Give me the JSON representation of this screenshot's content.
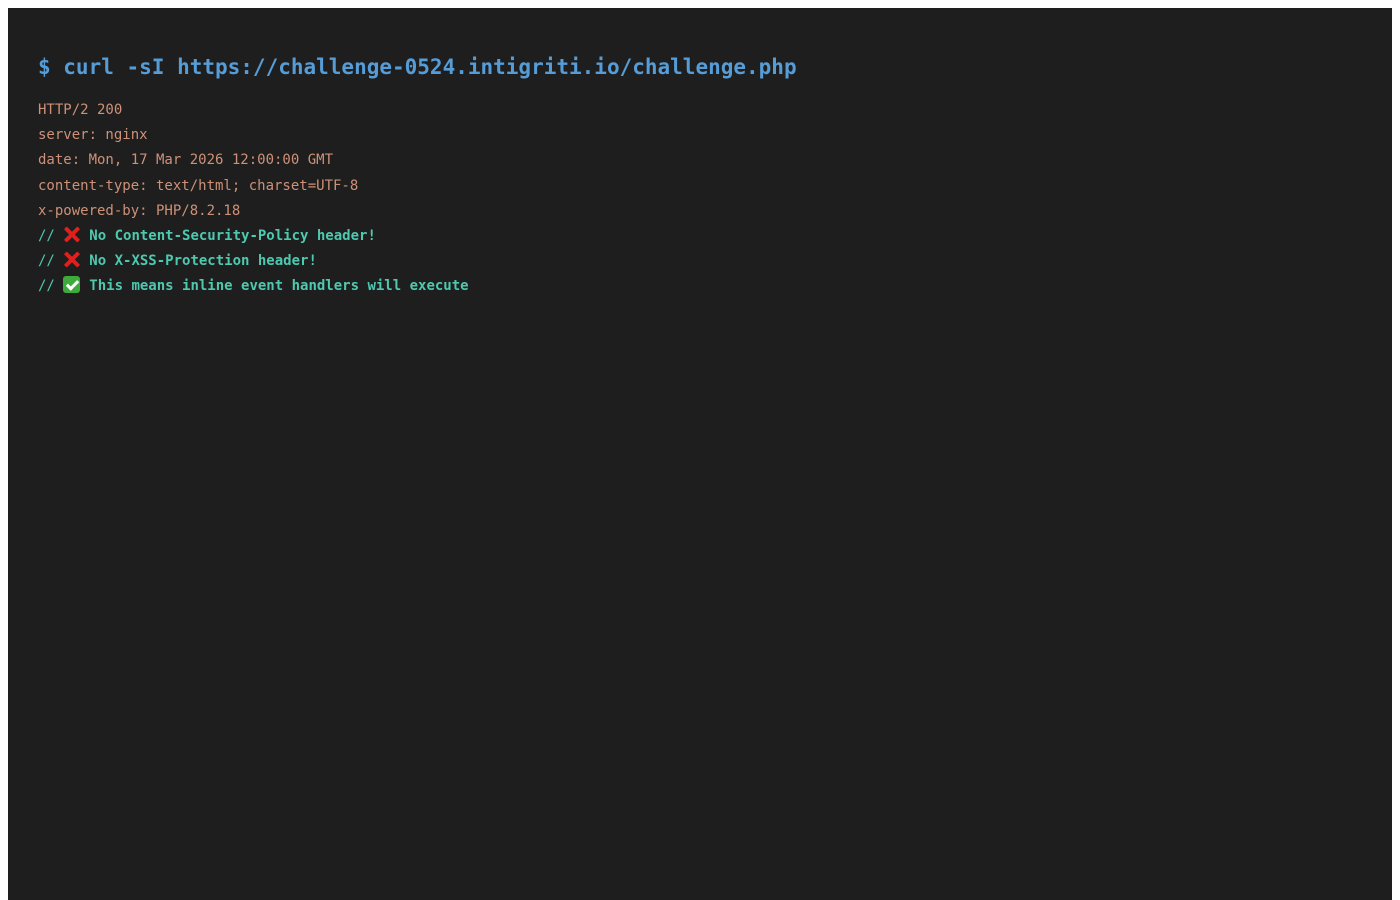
{
  "command": "$ curl -sI https://challenge-0524.intigriti.io/challenge.php",
  "headers": [
    "HTTP/2 200",
    "server: nginx",
    "date: Mon, 17 Mar 2026 12:00:00 GMT",
    "content-type: text/html; charset=UTF-8",
    "x-powered-by: PHP/8.2.18"
  ],
  "comments": [
    {
      "prefix": "// ",
      "icon": "cross-mark-icon",
      "text": "No Content-Security-Policy header!"
    },
    {
      "prefix": "// ",
      "icon": "cross-mark-icon",
      "text": "No X-XSS-Protection header!"
    },
    {
      "prefix": "// ",
      "icon": "check-mark-icon",
      "text": "This means inline event handlers will execute"
    }
  ],
  "colors": {
    "background": "#1e1e1e",
    "command": "#569cd6",
    "header": "#ce9178",
    "comment": "#4ec9b0",
    "cross": "#e0201c",
    "check": "#3dab3b"
  }
}
